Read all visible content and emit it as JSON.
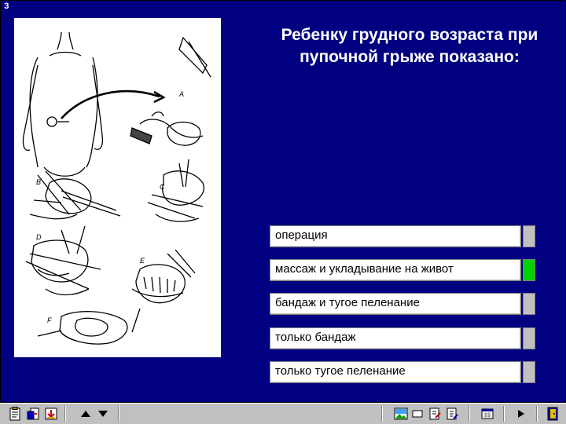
{
  "slide": {
    "number": "3"
  },
  "question": {
    "title": "Ребенку грудного возраста при пупочной грыже показано:"
  },
  "illustration": {
    "panel_labels": [
      "A",
      "B",
      "C",
      "D",
      "E",
      "F"
    ]
  },
  "answers": [
    {
      "label": "операция",
      "selected": false
    },
    {
      "label": "массаж и укладывание на живот",
      "selected": true
    },
    {
      "label": "бандаж и тугое пеленание",
      "selected": false
    },
    {
      "label": "только бандаж",
      "selected": false
    },
    {
      "label": "только тугое пеленание",
      "selected": false
    }
  ],
  "colors": {
    "background": "#000080",
    "indicator_selected": "#00d000",
    "indicator_default": "#c0c0c0"
  },
  "toolbar": {
    "left": [
      "clipboard-icon",
      "copy-icon",
      "download-icon"
    ],
    "nav": [
      "arrow-up-icon",
      "arrow-down-icon"
    ],
    "right": [
      "image-icon",
      "window-icon",
      "edit-doc-icon",
      "edit-doc2-icon",
      "calculator-icon",
      "play-icon",
      "exit-icon"
    ]
  }
}
